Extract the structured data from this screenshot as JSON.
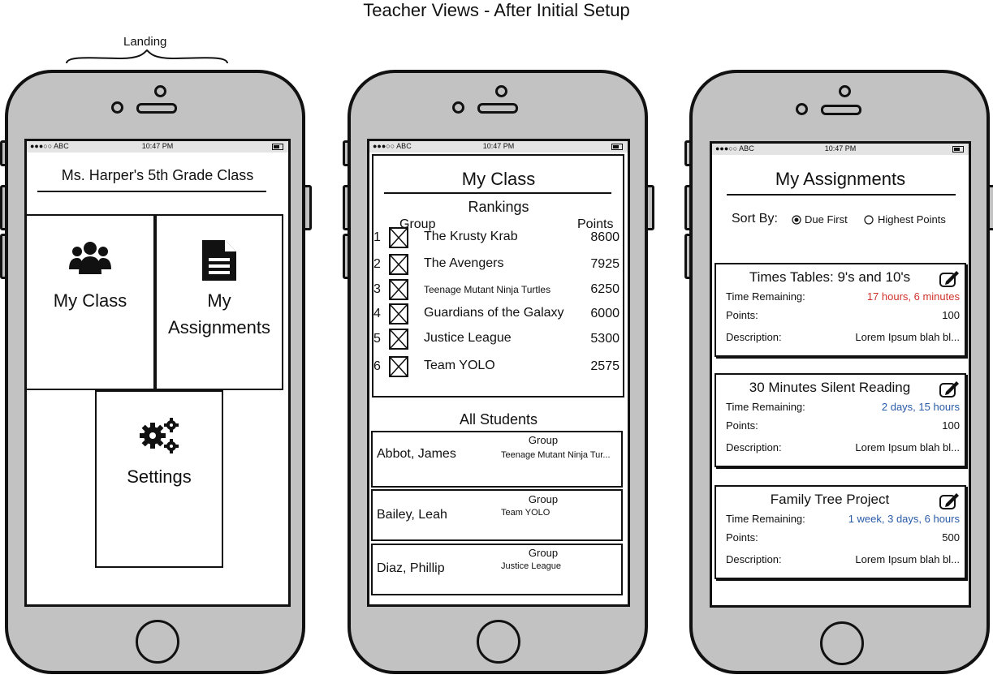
{
  "page": {
    "title": "Teacher Views - After Initial Setup",
    "landing_label": "Landing"
  },
  "status_bar": {
    "signal": "●●●○○ ABC",
    "time": "10:47 PM"
  },
  "landing": {
    "class_title": "Ms. Harper's 5th Grade Class",
    "tiles": {
      "my_class": "My Class",
      "my_assignments_line1": "My",
      "my_assignments_line2": "Assignments",
      "settings": "Settings"
    }
  },
  "my_class": {
    "title": "My Class",
    "rankings_heading": "Rankings",
    "col_group": "Group",
    "col_points": "Points",
    "rankings": [
      {
        "rank": "1",
        "name": "The Krusty Krab",
        "points": "8600"
      },
      {
        "rank": "2",
        "name": "The Avengers",
        "points": "7925"
      },
      {
        "rank": "3",
        "name": "Teenage Mutant Ninja Turtles",
        "points": "6250"
      },
      {
        "rank": "4",
        "name": "Guardians of the Galaxy",
        "points": "6000"
      },
      {
        "rank": "5",
        "name": "Justice League",
        "points": "5300"
      },
      {
        "rank": "6",
        "name": "Team YOLO",
        "points": "2575"
      }
    ],
    "all_students_heading": "All Students",
    "students": [
      {
        "name": "Abbot, James",
        "group_label": "Group",
        "group": "Teenage Mutant Ninja Tur..."
      },
      {
        "name": "Bailey, Leah",
        "group_label": "Group",
        "group": "Team YOLO"
      },
      {
        "name": "Diaz, Phillip",
        "group_label": "Group",
        "group": "Justice League"
      }
    ]
  },
  "assignments": {
    "title": "My Assignments",
    "sort_by_label": "Sort By:",
    "sort_options": [
      {
        "label": "Due First",
        "selected": true
      },
      {
        "label": "Highest Points",
        "selected": false
      }
    ],
    "labels": {
      "time_remaining": "Time Remaining:",
      "points": "Points:",
      "description": "Description:"
    },
    "items": [
      {
        "title": "Times Tables: 9's and 10's",
        "time_remaining": "17 hours, 6 minutes",
        "time_color": "#d0332c",
        "points": "100",
        "description": "Lorem Ipsum blah bl..."
      },
      {
        "title": "30 Minutes Silent Reading",
        "time_remaining": "2 days, 15 hours",
        "time_color": "#2a5ba8",
        "points": "100",
        "description": "Lorem Ipsum blah bl..."
      },
      {
        "title": "Family Tree Project",
        "time_remaining": "1 week, 3 days, 6 hours",
        "time_color": "#2a5ba8",
        "points": "500",
        "description": "Lorem Ipsum blah bl..."
      }
    ],
    "fab_icon": "plus-icon",
    "edit_icon": "edit-icon"
  }
}
